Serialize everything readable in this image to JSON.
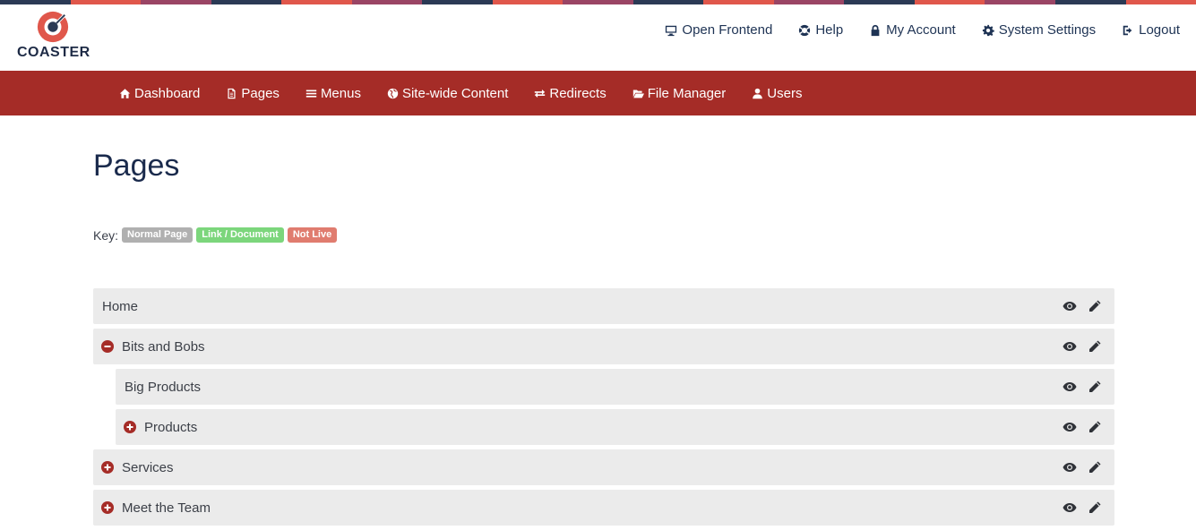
{
  "stripe_colors": [
    "#2b3a55",
    "#e0574b",
    "#9a4565",
    "#2b3a55",
    "#e0574b",
    "#9a4565",
    "#2b3a55",
    "#e0574b",
    "#9a4565",
    "#2b3a55",
    "#e0574b",
    "#9a4565",
    "#2b3a55",
    "#e0574b",
    "#9a4565",
    "#2b3a55",
    "#e0574b"
  ],
  "brand": {
    "name": "COASTER"
  },
  "topnav": [
    {
      "label": "Open Frontend",
      "icon": "monitor-icon"
    },
    {
      "label": "Help",
      "icon": "lifebuoy-icon"
    },
    {
      "label": "My Account",
      "icon": "lock-icon"
    },
    {
      "label": "System Settings",
      "icon": "gear-icon"
    },
    {
      "label": "Logout",
      "icon": "sign-out-icon"
    }
  ],
  "mainnav": [
    {
      "label": "Dashboard",
      "icon": "home-icon"
    },
    {
      "label": "Pages",
      "icon": "file-icon"
    },
    {
      "label": "Menus",
      "icon": "bars-icon"
    },
    {
      "label": "Site-wide Content",
      "icon": "globe-icon"
    },
    {
      "label": "Redirects",
      "icon": "exchange-icon"
    },
    {
      "label": "File Manager",
      "icon": "folder-open-icon"
    },
    {
      "label": "Users",
      "icon": "user-icon"
    }
  ],
  "page": {
    "title": "Pages",
    "key_label": "Key:",
    "key_badges": [
      {
        "label": "Normal Page",
        "color": "#b0b0b0"
      },
      {
        "label": "Link / Document",
        "color": "#7cd67c"
      },
      {
        "label": "Not Live",
        "color": "#e07c6f"
      }
    ]
  },
  "tree": [
    {
      "label": "Home",
      "toggle": null,
      "indent": false
    },
    {
      "label": "Bits and Bobs",
      "toggle": "minus",
      "indent": false
    },
    {
      "label": "Big Products",
      "toggle": null,
      "indent": true
    },
    {
      "label": "Products",
      "toggle": "plus",
      "indent": true
    },
    {
      "label": "Services",
      "toggle": "plus",
      "indent": false
    },
    {
      "label": "Meet the Team",
      "toggle": "plus",
      "indent": false
    }
  ],
  "colors": {
    "accent": "#a52c27",
    "navy": "#1e3354",
    "row_bg": "#ebebeb"
  }
}
